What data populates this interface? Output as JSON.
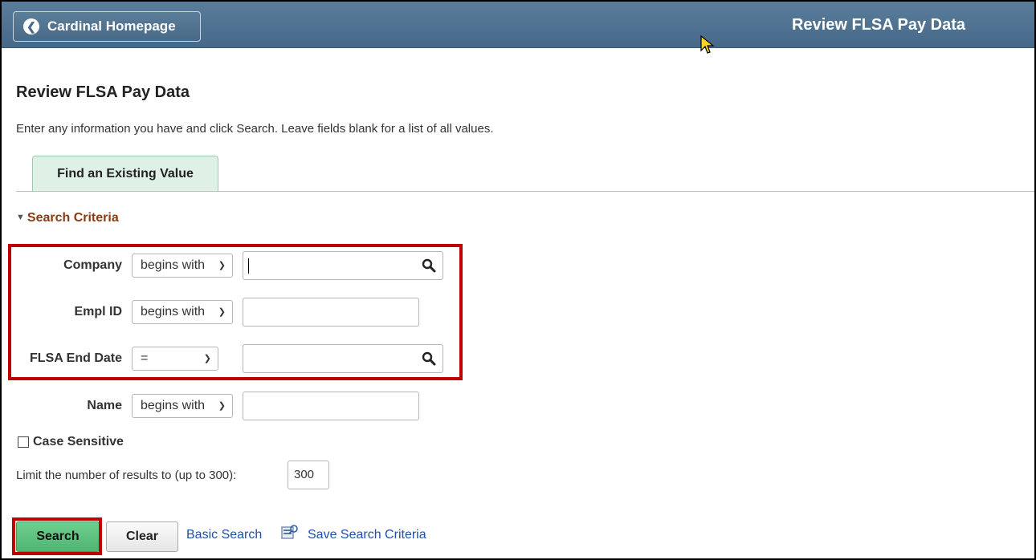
{
  "header": {
    "home_label": "Cardinal Homepage",
    "title": "Review FLSA Pay Data"
  },
  "page": {
    "title": "Review FLSA Pay Data",
    "instructions": "Enter any information you have and click Search. Leave fields blank for a list of all values."
  },
  "tabs": [
    {
      "label": "Find an Existing Value",
      "active": true
    }
  ],
  "search_criteria": {
    "heading": "Search Criteria",
    "fields": [
      {
        "label": "Company",
        "operator": "begins with",
        "value": "",
        "lookup": true
      },
      {
        "label": "Empl ID",
        "operator": "begins with",
        "value": "",
        "lookup": false
      },
      {
        "label": "FLSA End Date",
        "operator": "=",
        "value": "",
        "lookup": true
      },
      {
        "label": "Name",
        "operator": "begins with",
        "value": "",
        "lookup": false
      }
    ],
    "case_sensitive_label": "Case Sensitive",
    "case_sensitive_checked": false,
    "limit_label": "Limit the number of results to (up to 300):",
    "limit_value": "300"
  },
  "actions": {
    "search_label": "Search",
    "clear_label": "Clear",
    "basic_search_label": "Basic Search",
    "save_criteria_label": "Save Search Criteria"
  },
  "colors": {
    "banner": "#4a6f8e",
    "highlight": "#c00000",
    "search_button": "#5cc07f",
    "tab_bg": "#dff1e6",
    "section_heading": "#8a3b12",
    "link": "#1f4fa8"
  },
  "icons": [
    "chevron-left-icon",
    "mouse-cursor-icon",
    "magnifier-icon",
    "save-search-icon"
  ]
}
